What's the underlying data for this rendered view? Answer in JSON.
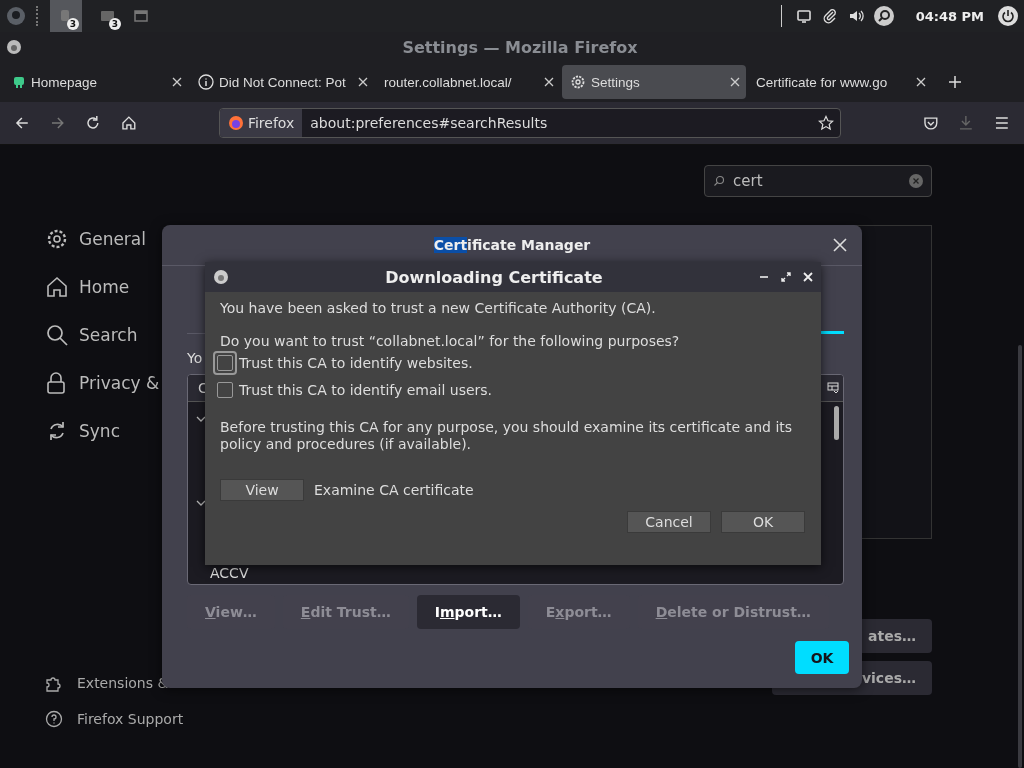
{
  "taskbar": {
    "badges": [
      "3",
      "3"
    ],
    "clock": "04:48 PM"
  },
  "window": {
    "title": "Settings — Mozilla Firefox"
  },
  "tabs": [
    {
      "label": "Homepage",
      "selected": false
    },
    {
      "label": "Did Not Connect: Pot",
      "selected": false
    },
    {
      "label": "router.collabnet.local/",
      "selected": false
    },
    {
      "label": "Settings",
      "selected": true
    },
    {
      "label": "Certificate for www.go",
      "selected": false
    }
  ],
  "navbar": {
    "identity": "Firefox",
    "url": "about:preferences#searchResults"
  },
  "sidebar": {
    "items": [
      {
        "label": "General"
      },
      {
        "label": "Home"
      },
      {
        "label": "Search"
      },
      {
        "label": "Privacy &"
      },
      {
        "label": "Sync"
      }
    ],
    "footer": [
      {
        "label": "Extensions &"
      },
      {
        "label": "Firefox Support"
      }
    ]
  },
  "search": {
    "value": "cert"
  },
  "background_buttons": [
    "ates…",
    "vices…"
  ],
  "certificate_manager": {
    "title_highlight": "Cert",
    "title_rest": "ificate Manager",
    "intro": "Yo",
    "table": {
      "column_1": "C",
      "rows": [
        "ACCV"
      ]
    },
    "buttons": [
      {
        "key": "V",
        "post": "iew…",
        "disabled": true
      },
      {
        "key": "E",
        "post": "dit Trust…",
        "disabled": true
      },
      {
        "pre": "I",
        "key": "m",
        "post": "port…",
        "disabled": false
      },
      {
        "pre": "E",
        "key": "x",
        "post": "port…",
        "disabled": true
      },
      {
        "key": "D",
        "post": "elete or Distrust…",
        "disabled": true
      }
    ],
    "ok": "OK"
  },
  "download_dialog": {
    "title": "Downloading Certificate",
    "message": "You have been asked to trust a new Certificate Authority (CA).",
    "question": "Do you want to trust “collabnet.local” for the following purposes?",
    "checkboxes": [
      {
        "label": "Trust this CA to identify websites.",
        "checked": false,
        "focused": true
      },
      {
        "label": "Trust this CA to identify email users.",
        "checked": false,
        "focused": false
      }
    ],
    "warning": "Before trusting this CA for any purpose, you should examine its certificate and its policy and procedures (if available).",
    "view_button": "View",
    "view_caption": "Examine CA certificate",
    "buttons": [
      "Cancel",
      "OK"
    ]
  }
}
